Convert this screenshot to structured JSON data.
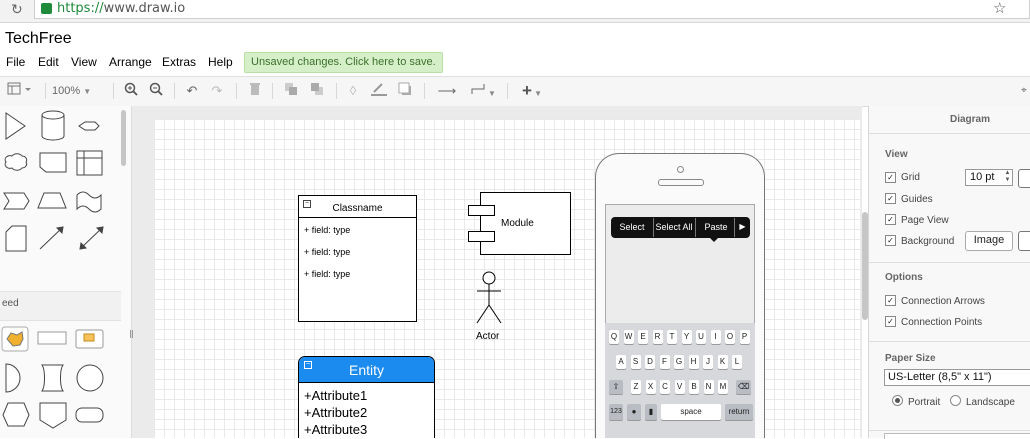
{
  "browser": {
    "url_scheme": "https://",
    "url_host": "www.draw.io",
    "reload_glyph": "↻",
    "star_glyph": "☆"
  },
  "app": {
    "title": "TechFree"
  },
  "menu": [
    "File",
    "Edit",
    "View",
    "Arrange",
    "Extras",
    "Help"
  ],
  "save_banner": "Unsaved changes. Click here to save.",
  "toolbar": {
    "zoom": "100%"
  },
  "sidebar": {
    "section_label": "eed"
  },
  "diagram": {
    "class": {
      "name": "Classname",
      "fields": [
        "+ field: type",
        "+ field: type",
        "+ field: type"
      ]
    },
    "module": {
      "label": "Module"
    },
    "actor": {
      "label": "Actor"
    },
    "entity": {
      "title": "Entity",
      "attributes": [
        "+Attribute1",
        "+Attribute2",
        "+Attribute3"
      ]
    },
    "phone": {
      "context_menu": [
        "Select",
        "Select All",
        "Paste",
        "▶"
      ],
      "keyboard": {
        "row1": [
          "Q",
          "W",
          "E",
          "R",
          "T",
          "Y",
          "U",
          "I",
          "O",
          "P"
        ],
        "row2": [
          "A",
          "S",
          "D",
          "F",
          "G",
          "H",
          "J",
          "K",
          "L"
        ],
        "row3": [
          "Z",
          "X",
          "C",
          "V",
          "B",
          "N",
          "M"
        ],
        "num_key": "123",
        "space": "space",
        "return": "return"
      }
    }
  },
  "format_panel": {
    "tab": "Diagram",
    "view_heading": "View",
    "grid_label": "Grid",
    "grid_size": "10 pt",
    "guides_label": "Guides",
    "page_view_label": "Page View",
    "background_label": "Background",
    "image_button": "Image",
    "options_heading": "Options",
    "connection_arrows_label": "Connection Arrows",
    "connection_points_label": "Connection Points",
    "paper_size_heading": "Paper Size",
    "paper_size_value": "US-Letter (8,5\" x 11\")",
    "portrait_label": "Portrait",
    "landscape_label": "Landscape"
  },
  "colors": {
    "entity_header": "#1c8bf0",
    "save_banner_bg": "#d5f0c8",
    "secure_lock": "#1e8a3a"
  }
}
